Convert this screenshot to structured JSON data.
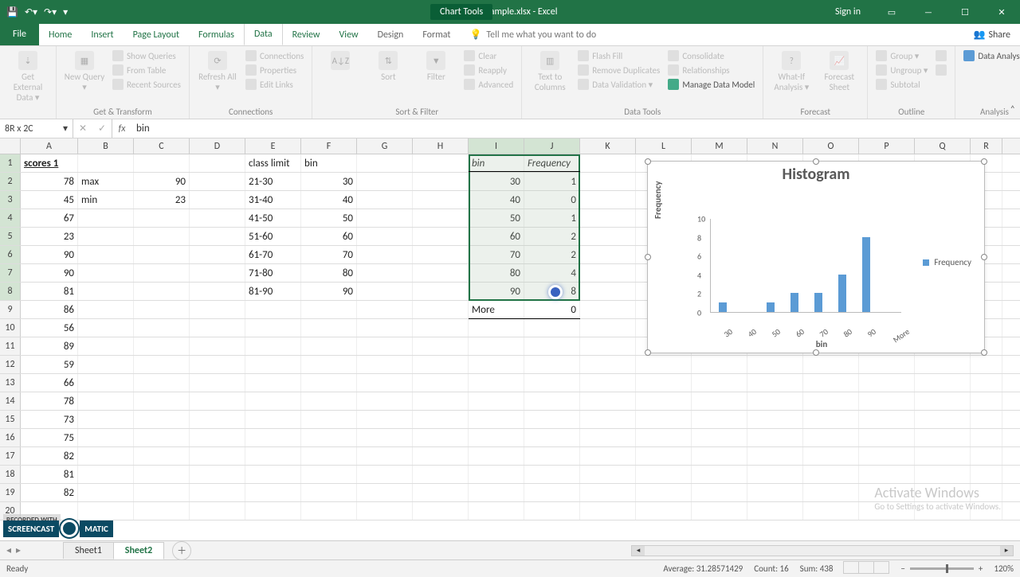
{
  "titlebar": {
    "title": "video sample.xlsx - Excel",
    "context": "Chart Tools",
    "signin": "Sign in"
  },
  "tabs": {
    "file": "File",
    "home": "Home",
    "insert": "Insert",
    "pagelayout": "Page Layout",
    "formulas": "Formulas",
    "data": "Data",
    "review": "Review",
    "view": "View",
    "design": "Design",
    "format": "Format",
    "tellme": "Tell me what you want to do",
    "share": "Share"
  },
  "ribbon": {
    "g1": {
      "btn1": "Get External Data ▾",
      "label": ""
    },
    "g2": {
      "btn1": "New Query ▾",
      "o1": "Show Queries",
      "o2": "From Table",
      "o3": "Recent Sources",
      "label": "Get & Transform"
    },
    "g3": {
      "btn1": "Refresh All ▾",
      "o1": "Connections",
      "o2": "Properties",
      "o3": "Edit Links",
      "label": "Connections"
    },
    "g4": {
      "btn1": "Sort",
      "btn2": "Filter",
      "o1": "Clear",
      "o2": "Reapply",
      "o3": "Advanced",
      "label": "Sort & Filter"
    },
    "g5": {
      "btn1": "Text to Columns",
      "o1": "Flash Fill",
      "o2": "Remove Duplicates",
      "o3": "Data Validation ▾",
      "o4": "Consolidate",
      "o5": "Relationships",
      "o6": "Manage Data Model",
      "label": "Data Tools"
    },
    "g6": {
      "btn1": "What-If Analysis ▾",
      "btn2": "Forecast Sheet",
      "label": "Forecast"
    },
    "g7": {
      "o1": "Group ▾",
      "o2": "Ungroup ▾",
      "o3": "Subtotal",
      "label": "Outline"
    },
    "g8": {
      "o1": "Data Analysis",
      "label": "Analysis"
    }
  },
  "namebox": "8R x 2C",
  "formula": "bin",
  "columns": [
    "A",
    "B",
    "C",
    "D",
    "E",
    "F",
    "G",
    "H",
    "I",
    "J",
    "K",
    "L",
    "M",
    "N",
    "O",
    "P",
    "Q",
    "R"
  ],
  "rows": [
    "1",
    "2",
    "3",
    "4",
    "5",
    "6",
    "7",
    "8",
    "9",
    "10",
    "11",
    "12",
    "13",
    "14",
    "15",
    "16",
    "17",
    "18",
    "19",
    "20"
  ],
  "cells": {
    "A1": "scores 1",
    "A2": "78",
    "A3": "45",
    "A4": "67",
    "A5": "23",
    "A6": "90",
    "A7": "90",
    "A8": "81",
    "A9": "86",
    "A10": "56",
    "A11": "89",
    "A12": "59",
    "A13": "66",
    "A14": "78",
    "A15": "73",
    "A16": "75",
    "A17": "82",
    "A18": "81",
    "A19": "82",
    "B2": "max",
    "B3": "min",
    "C2": "90",
    "C3": "23",
    "E1": "class limit",
    "E2": "21-30",
    "E3": "31-40",
    "E4": "41-50",
    "E5": "51-60",
    "E6": "61-70",
    "E7": "71-80",
    "E8": "81-90",
    "F1": "bin",
    "F2": "30",
    "F3": "40",
    "F4": "50",
    "F5": "60",
    "F6": "70",
    "F7": "80",
    "F8": "90",
    "I1": "bin",
    "J1": "Frequency",
    "I2": "30",
    "J2": "1",
    "I3": "40",
    "J3": "0",
    "I4": "50",
    "J4": "1",
    "I5": "60",
    "J5": "2",
    "I6": "70",
    "J6": "2",
    "I7": "80",
    "J7": "4",
    "I8": "90",
    "J8": "8",
    "I9": "More",
    "J9": "0"
  },
  "chart_data": {
    "type": "bar",
    "title": "Histogram",
    "categories": [
      "30",
      "40",
      "50",
      "60",
      "70",
      "80",
      "90",
      "More"
    ],
    "series": [
      {
        "name": "Frequency",
        "values": [
          1,
          0,
          1,
          2,
          2,
          4,
          8,
          0
        ]
      }
    ],
    "xlabel": "bin",
    "ylabel": "Frequency",
    "ylim": [
      0,
      10
    ],
    "yticks": [
      0,
      2,
      4,
      6,
      8,
      10
    ]
  },
  "sheettabs": {
    "s1": "Sheet1",
    "s2": "Sheet2"
  },
  "statusbar": {
    "ready": "Ready",
    "avg": "Average: 31.28571429",
    "count": "Count: 16",
    "sum": "Sum: 438",
    "zoom": "120%"
  },
  "watermark": {
    "l1": "Activate Windows",
    "l2": "Go to Settings to activate Windows."
  },
  "som": {
    "rec": "RECORDED WITH",
    "brand": "SCREENCAST",
    "brand2": "MATIC"
  }
}
